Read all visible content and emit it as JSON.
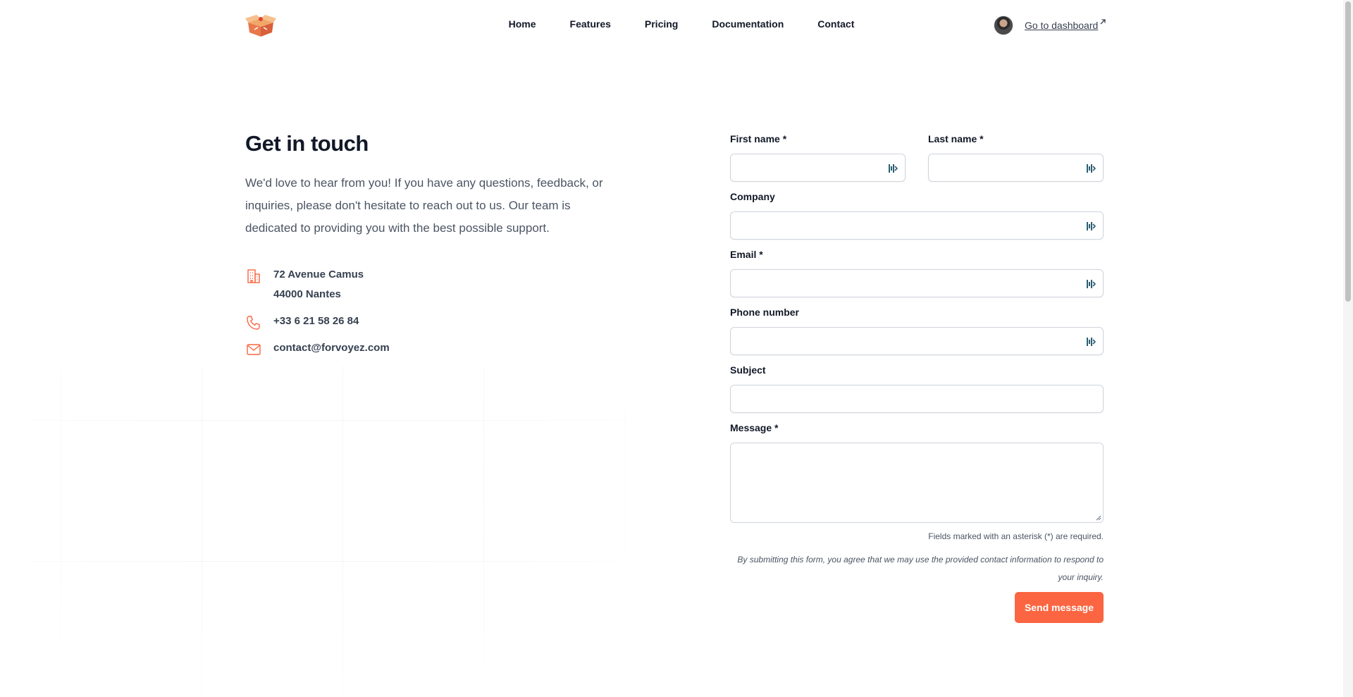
{
  "header": {
    "logo_name": "box-logo-icon",
    "nav": [
      "Home",
      "Features",
      "Pricing",
      "Documentation",
      "Contact"
    ],
    "dashboard_link": "Go to dashboard"
  },
  "contact": {
    "title": "Get in touch",
    "intro": "We'd love to hear from you! If you have any questions, feedback, or inquiries, please don't hesitate to reach out to us. Our team is dedicated to providing you with the best possible support.",
    "address_line1": "72 Avenue Camus",
    "address_line2": "44000 Nantes",
    "phone": "+33 6 21 58 26 84",
    "email": "contact@forvoyez.com"
  },
  "form": {
    "first_name_label": "First name *",
    "last_name_label": "Last name *",
    "company_label": "Company",
    "email_label": "Email *",
    "phone_label": "Phone number",
    "subject_label": "Subject",
    "message_label": "Message *",
    "required_note": "Fields marked with an asterisk (*) are required.",
    "terms": "By submitting this form, you agree that we may use the provided contact information to respond to your inquiry.",
    "submit": "Send message"
  },
  "colors": {
    "accent": "#fb6541",
    "text_dark": "#111827",
    "text_muted": "#4b5563"
  }
}
